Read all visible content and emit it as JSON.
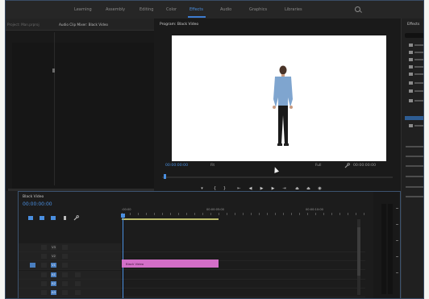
{
  "workspaces": [
    "Learning",
    "Assembly",
    "Editing",
    "Color",
    "Effects",
    "Audio",
    "Graphics",
    "Libraries"
  ],
  "active_workspace": "Effects",
  "source_panel_tabs": [
    "Project: Man.prproj",
    "Audio Clip Mixer: Black Video"
  ],
  "program_monitor": {
    "tab_label": "Program: Black Video",
    "timecode_current": "00:00:00:00",
    "fit_label": "Fit",
    "full_label": "Full",
    "timecode_duration": "00:00:00:00"
  },
  "right_panel": {
    "tab_label": "Effects"
  },
  "timeline": {
    "tab_label": "Black Video",
    "timecode": "00:00:00:00",
    "ruler_labels": [
      ":00:00",
      "00:00:05:00",
      "00:00:10:00"
    ],
    "clip_label": "Black Video",
    "track_labels": [
      "V3",
      "V2",
      "V1",
      "A1",
      "A2",
      "A3"
    ]
  },
  "colors": {
    "accent": "#4a8fe0",
    "clip": "#d46fc8",
    "panel_bg": "#1e1e1e",
    "frame_border": "#3a4c64"
  },
  "icons": [
    "search-icon",
    "wrench-icon",
    "play-icon",
    "settings-icon",
    "folder-icon"
  ]
}
